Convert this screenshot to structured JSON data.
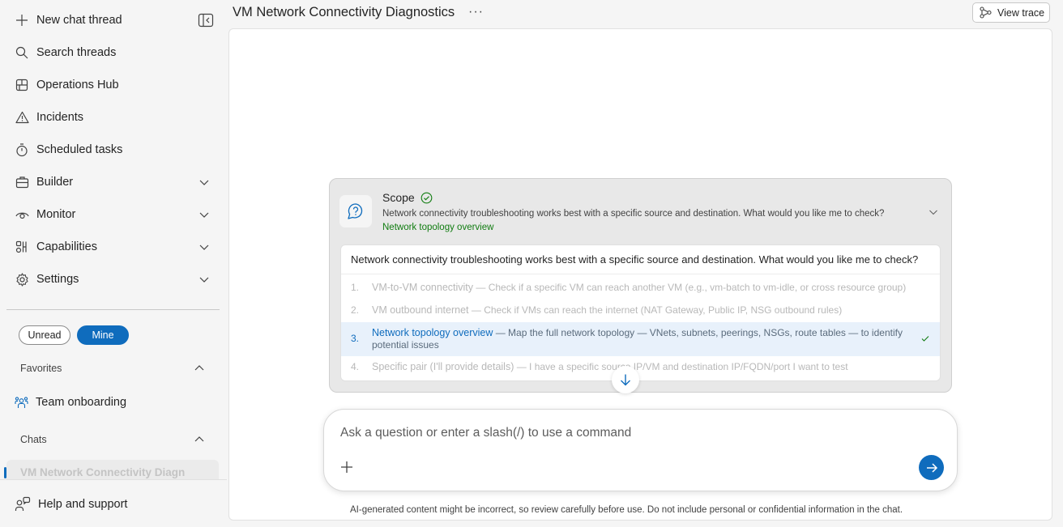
{
  "sidebar": {
    "new_chat": "New chat thread",
    "items": [
      {
        "label": "Search threads"
      },
      {
        "label": "Operations Hub"
      },
      {
        "label": "Incidents"
      },
      {
        "label": "Scheduled tasks"
      },
      {
        "label": "Builder"
      },
      {
        "label": "Monitor"
      },
      {
        "label": "Capabilities"
      },
      {
        "label": "Settings"
      }
    ],
    "filters": {
      "unread": "Unread",
      "mine": "Mine"
    },
    "favorites_label": "Favorites",
    "favorites": [
      {
        "label": "Team onboarding"
      }
    ],
    "chats_label": "Chats",
    "chats": [
      {
        "label": "VM Network Connectivity Diagn"
      }
    ],
    "help": "Help and support"
  },
  "header": {
    "title": "VM Network Connectivity Diagnostics",
    "more": "···",
    "view_trace": "View trace"
  },
  "card": {
    "title": "Scope",
    "description": "Network connectivity troubleshooting works best with a specific source and destination. What would you like me to check?",
    "answer": "Network topology overview",
    "question": "Network connectivity troubleshooting works best with a specific source and destination. What would you like me to check?",
    "options": [
      {
        "num": "1.",
        "title": "VM-to-VM connectivity",
        "desc": " — Check if a specific VM can reach another VM (e.g., vm-batch to vm-idle, or cross resource group)"
      },
      {
        "num": "2.",
        "title": "VM outbound internet",
        "desc": " — Check if VMs can reach the internet (NAT Gateway, Public IP, NSG outbound rules)"
      },
      {
        "num": "3.",
        "title": "Network topology overview",
        "desc": " — Map the full network topology — VNets, subnets, peerings, NSGs, route tables — to identify potential issues"
      },
      {
        "num": "4.",
        "title": "Specific pair (I'll provide details)",
        "desc": " — I have a specific source IP/VM and destination IP/FQDN/port I want to test"
      }
    ]
  },
  "composer": {
    "placeholder": "Ask a question or enter a slash(/) to use a command"
  },
  "disclaimer": "AI-generated content might be incorrect, so review carefully before use. Do not include personal or confidential information in the chat.",
  "colors": {
    "accent": "#0f6cbd",
    "success": "#107c10"
  }
}
